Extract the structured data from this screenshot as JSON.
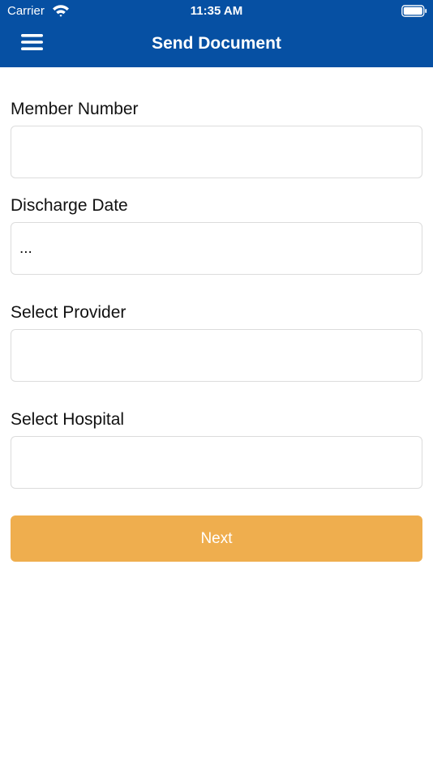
{
  "status_bar": {
    "carrier": "Carrier",
    "time": "11:35 AM",
    "icons": [
      "wifi-icon",
      "battery-icon"
    ]
  },
  "nav": {
    "title": "Send Document",
    "menu_icon": "hamburger-menu-icon"
  },
  "form": {
    "fields": [
      {
        "label": "Member Number",
        "value": ""
      },
      {
        "label": "Discharge Date",
        "value": "..."
      },
      {
        "label": "Select Provider",
        "value": ""
      },
      {
        "label": "Select Hospital",
        "value": ""
      }
    ],
    "next_label": "Next"
  },
  "colors": {
    "header": "#0650a3",
    "button": "#efae4e",
    "field_border": "#dcdcdc"
  }
}
